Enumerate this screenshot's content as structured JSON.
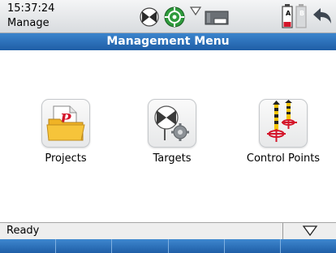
{
  "header": {
    "time": "15:37:24",
    "app_name": "Manage",
    "icons": [
      "prism-icon",
      "target-lock-icon",
      "wireless-icon",
      "instrument-icon",
      "battery-a-icon",
      "battery-b-icon",
      "back-arrow-icon"
    ],
    "battery_labels": [
      "A",
      "B"
    ]
  },
  "title": "Management Menu",
  "menu": [
    {
      "label": "Projects",
      "icon": "projects-folder-icon"
    },
    {
      "label": "Targets",
      "icon": "targets-prism-icon"
    },
    {
      "label": "Control Points",
      "icon": "control-points-icon"
    }
  ],
  "status": {
    "text": "Ready",
    "dropdown_icon": "triangle-down-icon"
  },
  "softkeys": [
    "",
    "",
    "",
    "",
    "",
    ""
  ],
  "colors": {
    "title_bar": "#2a6fb8",
    "softkey": "#2a6fb8",
    "accent_red": "#d4152a",
    "accent_yellow": "#f3c500",
    "folder_yellow": "#f6c43a"
  }
}
